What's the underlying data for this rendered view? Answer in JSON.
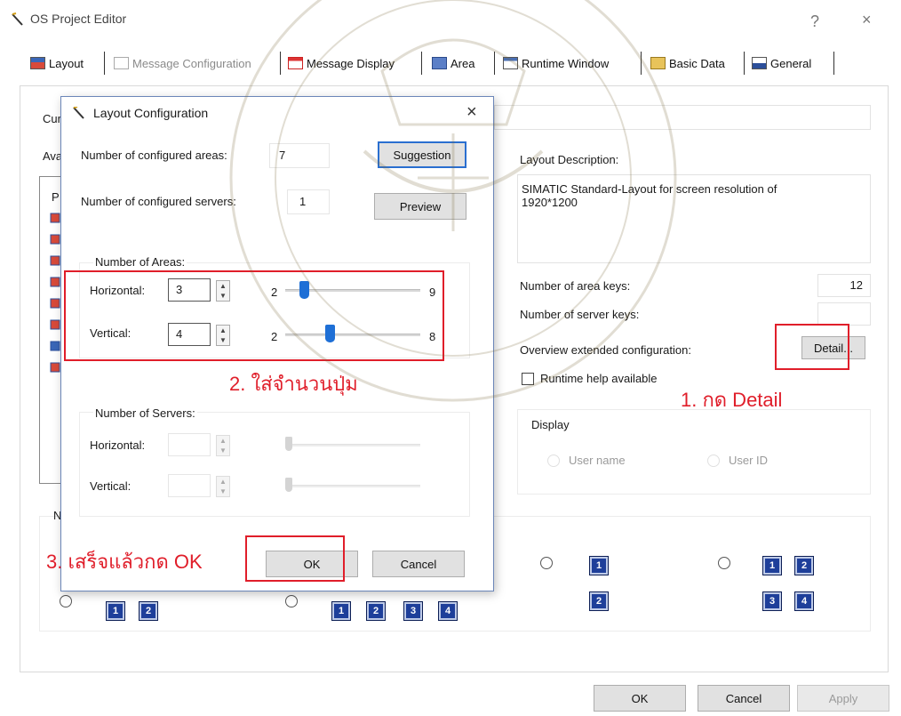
{
  "window": {
    "title": "OS Project Editor",
    "help_glyph": "?",
    "close_glyph": "×"
  },
  "tabs": [
    {
      "label": "Layout",
      "icon": "layout-icon"
    },
    {
      "label": "Message Configuration",
      "icon": "message-config-icon"
    },
    {
      "label": "Message Display",
      "icon": "message-display-icon"
    },
    {
      "label": "Area",
      "icon": "area-icon"
    },
    {
      "label": "Runtime Window",
      "icon": "runtime-window-icon"
    },
    {
      "label": "Basic Data",
      "icon": "basic-data-icon"
    },
    {
      "label": "General",
      "icon": "general-icon"
    }
  ],
  "layout_tab": {
    "current_label_partial": "Cur",
    "available_label_partial": "Ava",
    "list_partial": "P",
    "layout_description_label": "Layout Description:",
    "layout_description_text": "SIMATIC Standard-Layout for screen resolution of 1920*1200",
    "area_keys_label": "Number of area keys:",
    "area_keys_value": "12",
    "server_keys_label": "Number of server keys:",
    "server_keys_value": "",
    "overview_label": "Overview extended configuration:",
    "detail_button": "Detail...",
    "runtime_help_label": "Runtime help available",
    "runtime_help_checked": false,
    "display_group_label": "Display",
    "display_user_name": "User name",
    "display_user_id": "User ID",
    "overview_group_partial": "N",
    "area_buttons_layout1": [
      "1",
      "2"
    ],
    "area_buttons_layout2": [
      "1",
      "2",
      "3",
      "4"
    ],
    "area_buttons_layout3": [
      "1",
      "2"
    ],
    "area_buttons_layout4": [
      "1",
      "2",
      "3",
      "4"
    ]
  },
  "dialog": {
    "title": "Layout Configuration",
    "close_glyph": "×",
    "configured_areas_label": "Number of configured areas:",
    "configured_areas_value": "7",
    "configured_servers_label": "Number of configured servers:",
    "configured_servers_value": "1",
    "suggestion_button": "Suggestion",
    "preview_button": "Preview",
    "areas_group_label": "Number of Areas:",
    "areas_horizontal_label": "Horizontal:",
    "areas_horizontal_value": "3",
    "areas_horizontal_min": "2",
    "areas_horizontal_max": "9",
    "areas_horizontal_slider_position": 0.14,
    "areas_vertical_label": "Vertical:",
    "areas_vertical_value": "4",
    "areas_vertical_min": "2",
    "areas_vertical_max": "8",
    "areas_vertical_slider_position": 0.33,
    "servers_group_label": "Number of Servers:",
    "servers_horizontal_label": "Horizontal:",
    "servers_horizontal_value": "",
    "servers_vertical_label": "Vertical:",
    "servers_vertical_value": "",
    "ok_button": "OK",
    "cancel_button": "Cancel"
  },
  "footer": {
    "ok_button": "OK",
    "cancel_button": "Cancel",
    "apply_button": "Apply"
  },
  "annotations": {
    "step1": "1. กด Detail",
    "step2": "2. ใส่จำนวนปุ่ม",
    "step3": "3. เสร็จแล้วกด OK",
    "color": "#e01e2a"
  },
  "colors": {
    "accent_blue": "#1e6fd6",
    "area_button_blue": "#1e3f9a",
    "annotation_red": "#e01e2a"
  }
}
